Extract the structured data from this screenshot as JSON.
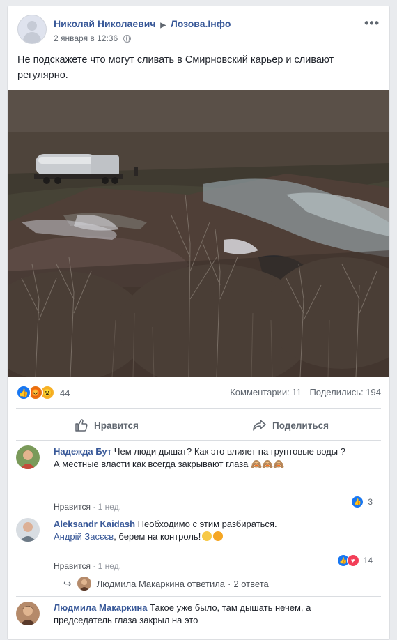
{
  "post": {
    "author": "Николай Николаевич",
    "target_group": "Лозова.Інфо",
    "timestamp": "2 января в 12:36",
    "text": "Не подскажете что могут сливать в Смирновский карьер и сливают регулярно.",
    "reactions_count": "44",
    "comments_label": "Комментарии: 11",
    "shares_label": "Поделились: 194"
  },
  "actions": {
    "like_label": "Нравится",
    "share_label": "Поделиться"
  },
  "comments": [
    {
      "author": "Надежда Бут",
      "text_1": "Чем люди дышат? Как это влияет на грунтовые воды ?",
      "text_2": "А местные власти как всегда закрывают глаза 🙈🙈🙈",
      "like_label": "Нравится",
      "age": "1 нед.",
      "reaction_count": "3"
    },
    {
      "author": "Aleksandr Kaidash",
      "text_1": "Необходимо с этим разбираться.",
      "mention": "Андрій Засєєв",
      "text_2": ", берем на контроль!",
      "like_label": "Нравится",
      "age": "1 нед.",
      "reaction_count": "14"
    },
    {
      "author": "Людмила Макаркина",
      "text_1": "Такое уже было, там дышать нечем, а председатель глаза закрыл на это"
    }
  ],
  "reply_thread": {
    "text": "Людмила Макаркина ответила",
    "count": "2 ответа"
  },
  "icons": [
    "more-icon",
    "globe-icon",
    "like-icon",
    "share-icon",
    "reply-arrow-icon"
  ],
  "colors": {
    "link": "#385898",
    "facebook_blue": "#1877f2",
    "meta_gray": "#606770"
  }
}
